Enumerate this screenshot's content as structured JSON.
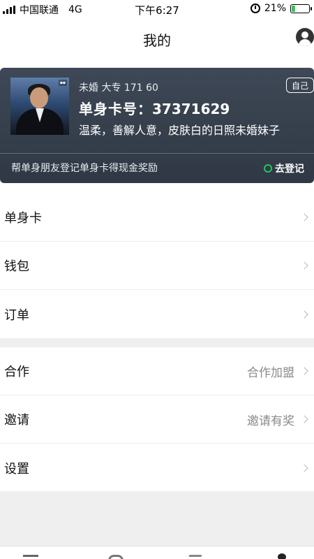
{
  "status_bar": {
    "carrier": "中国联通",
    "network": "4G",
    "time": "下午6:27",
    "battery_percent": "21%",
    "battery_level": 0.21
  },
  "header": {
    "title": "我的"
  },
  "card": {
    "meta": "未婚 大专 171 60",
    "self_badge": "自己",
    "card_no_label": "单身卡号：",
    "card_no": "37371629",
    "description": "温柔，善解人意，皮肤白的日照未婚妹子",
    "promo": "帮单身朋友登记单身卡得现金奖励",
    "register_label": "去登记"
  },
  "menu": {
    "group1": [
      {
        "label": "单身卡"
      },
      {
        "label": "钱包"
      },
      {
        "label": "订单"
      }
    ],
    "group2": [
      {
        "label": "合作",
        "value": "合作加盟"
      },
      {
        "label": "邀请",
        "value": "邀请有奖"
      },
      {
        "label": "设置"
      }
    ]
  },
  "colors": {
    "card_bg": "#3b4552",
    "accent_green": "#22c55e",
    "battery_green": "#35c759"
  }
}
